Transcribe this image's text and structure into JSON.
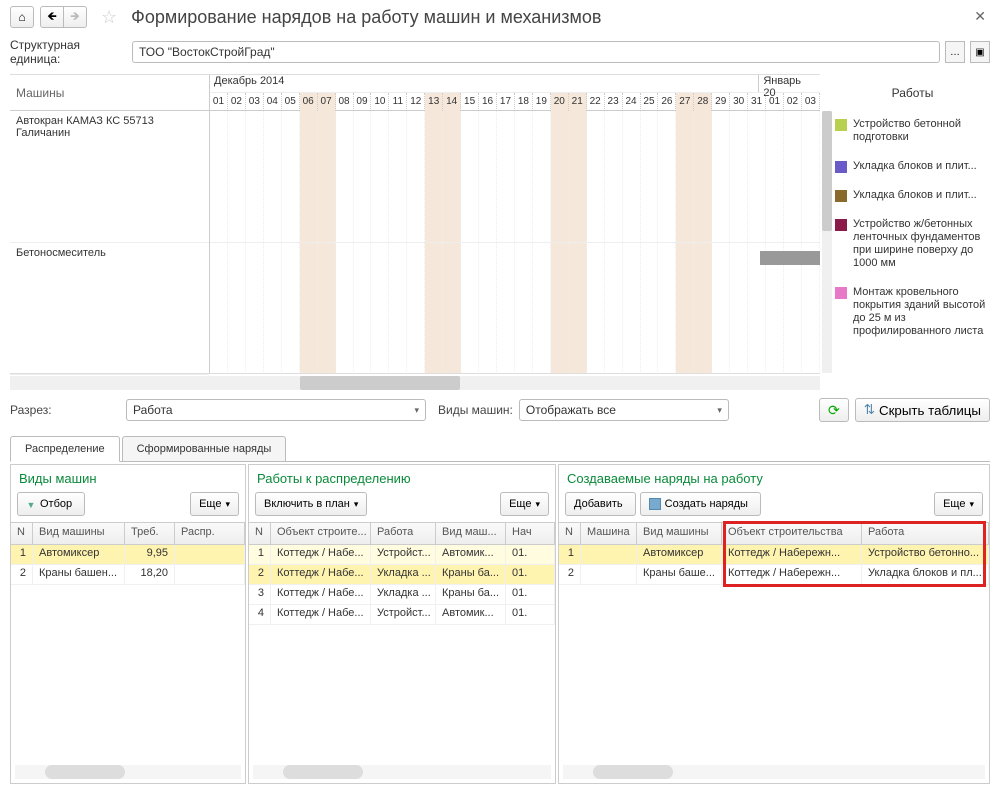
{
  "header": {
    "title": "Формирование нарядов на работу машин и механизмов"
  },
  "form": {
    "unit_label": "Структурная единица:",
    "unit_value": "ТОО \"ВостокСтройГрад\""
  },
  "gantt": {
    "machines_label": "Машины",
    "month1": "Декабрь 2014",
    "month2": "Январь 20",
    "days": [
      "01",
      "02",
      "03",
      "04",
      "05",
      "06",
      "07",
      "08",
      "09",
      "10",
      "11",
      "12",
      "13",
      "14",
      "15",
      "16",
      "17",
      "18",
      "19",
      "20",
      "21",
      "22",
      "23",
      "24",
      "25",
      "26",
      "27",
      "28",
      "29",
      "30",
      "31",
      "01",
      "02",
      "03"
    ],
    "weekend_indices": [
      5,
      6,
      12,
      13,
      19,
      20,
      26,
      27
    ],
    "rows": [
      {
        "name": "Автокран КАМАЗ КС 55713 Галичанин"
      },
      {
        "name": "Бетоносмеситель"
      }
    ]
  },
  "legend": {
    "title": "Работы",
    "items": [
      {
        "color": "#b8d050",
        "label": "Устройство бетонной подготовки"
      },
      {
        "color": "#6a5ac8",
        "label": "Укладка блоков и плит..."
      },
      {
        "color": "#8a6a2a",
        "label": "Укладка блоков и плит..."
      },
      {
        "color": "#8a1a4a",
        "label": "Устройство ж/бетонных ленточных фундаментов при ширине поверху до 1000 мм"
      },
      {
        "color": "#e878c8",
        "label": "Монтаж кровельного покрытия зданий высотой до 25 м из профилированного листа"
      }
    ]
  },
  "filters": {
    "razrez_label": "Разрез:",
    "razrez_value": "Работа",
    "vidy_label": "Виды машин:",
    "vidy_value": "Отображать все",
    "hide_tables": "Скрыть таблицы"
  },
  "tabs": {
    "t1": "Распределение",
    "t2": "Сформированные наряды"
  },
  "panel1": {
    "title": "Виды машин",
    "filter": "Отбор",
    "more": "Еще",
    "cols": {
      "n": "N",
      "vid": "Вид машины",
      "treb": "Треб.",
      "raspr": "Распр."
    },
    "rows": [
      {
        "n": "1",
        "vid": "Автомиксер",
        "treb": "9,95",
        "raspr": ""
      },
      {
        "n": "2",
        "vid": "Краны башен...",
        "treb": "18,20",
        "raspr": ""
      }
    ]
  },
  "panel2": {
    "title": "Работы к распределению",
    "include": "Включить в план",
    "more": "Еще",
    "cols": {
      "n": "N",
      "obj": "Объект строите...",
      "rab": "Работа",
      "vid": "Вид маш...",
      "nach": "Нач"
    },
    "rows": [
      {
        "n": "1",
        "obj": "Коттедж / Набе...",
        "rab": "Устройст...",
        "vid": "Автомик...",
        "nach": "01."
      },
      {
        "n": "2",
        "obj": "Коттедж / Набе...",
        "rab": "Укладка ...",
        "vid": "Краны ба...",
        "nach": "01."
      },
      {
        "n": "3",
        "obj": "Коттедж / Набе...",
        "rab": "Укладка ...",
        "vid": "Краны ба...",
        "nach": "01."
      },
      {
        "n": "4",
        "obj": "Коттедж / Набе...",
        "rab": "Устройст...",
        "vid": "Автомик...",
        "nach": "01."
      }
    ]
  },
  "panel3": {
    "title": "Создаваемые наряды на работу",
    "add": "Добавить",
    "create": "Создать наряды",
    "more": "Еще",
    "cols": {
      "n": "N",
      "mash": "Машина",
      "vid": "Вид машины",
      "obj": "Объект строительства",
      "rab": "Работа"
    },
    "rows": [
      {
        "n": "1",
        "mash": "",
        "vid": "Автомиксер",
        "obj": "Коттедж / Набережн...",
        "rab": "Устройство бетонно..."
      },
      {
        "n": "2",
        "mash": "",
        "vid": "Краны баше...",
        "obj": "Коттедж / Набережн...",
        "rab": "Укладка блоков и пл..."
      }
    ]
  }
}
